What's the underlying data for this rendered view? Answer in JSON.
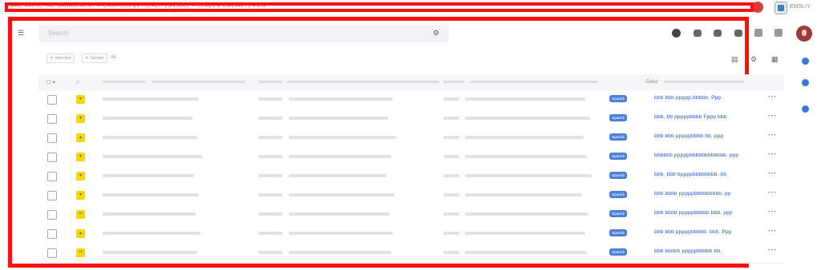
{
  "topbar": {
    "text": "EMAIL MARKETING MANAGEMENT — CAMPAIGN OUTREACH CONSOLE — LEADS & CONTACTS VIEW",
    "app_label": "EMSLIY"
  },
  "search": {
    "placeholder": "Search",
    "options_icon": "sliders-icon"
  },
  "filters": {
    "chip1": "✕ selected",
    "chip2": "✕ Sender",
    "clear": "All"
  },
  "table": {
    "headers": {
      "select": "☐ ▾",
      "star": "☆",
      "desc": "Desc"
    },
    "rows": [
      {
        "tag": "Spanish",
        "link": "bbb bbb ppppp.bbbbb. Ppp",
        "action": "• • •",
        "sticky": "▾"
      },
      {
        "tag": "Spanish",
        "link": "bbb. bb pppppbbbb Fppp bbb",
        "action": "• • •",
        "sticky": "▾"
      },
      {
        "tag": "Spanish",
        "link": "bbb bbb pppppbbbb bb. ppp",
        "action": "• • •",
        "sticky": "▴"
      },
      {
        "tag": "Spanish",
        "link": "bbbbbb pppppbbbbbbbbbbbb. ppp",
        "action": "• • •",
        "sticky": "▾"
      },
      {
        "tag": "Spanish",
        "link": "bbb. bbb bppppbbbbbbbb. bb",
        "action": "• • •",
        "sticky": "▾"
      },
      {
        "tag": "Spanish",
        "link": "bbb bbbb pppppbbbbbbbbb. pp",
        "action": "• • •",
        "sticky": "▾"
      },
      {
        "tag": "Spanish",
        "link": "bbb bbbb pppppbbbbb bbb. ppp",
        "action": "• • •",
        "sticky": "••"
      },
      {
        "tag": "Spanish",
        "link": "bbb bbb pppppbbbbb. bbb. Ppp",
        "action": "• • •",
        "sticky": "▴"
      },
      {
        "tag": "Spanish",
        "link": "bbb bbbbb pppppbbbbb bb.",
        "action": "• • •",
        "sticky": "••"
      }
    ]
  },
  "icons": {
    "left_logo": "☰"
  },
  "colors": {
    "highlight": "#ff1010",
    "tag": "#4b7fd9",
    "link": "#2456c9",
    "sticky": "#f4d800"
  }
}
